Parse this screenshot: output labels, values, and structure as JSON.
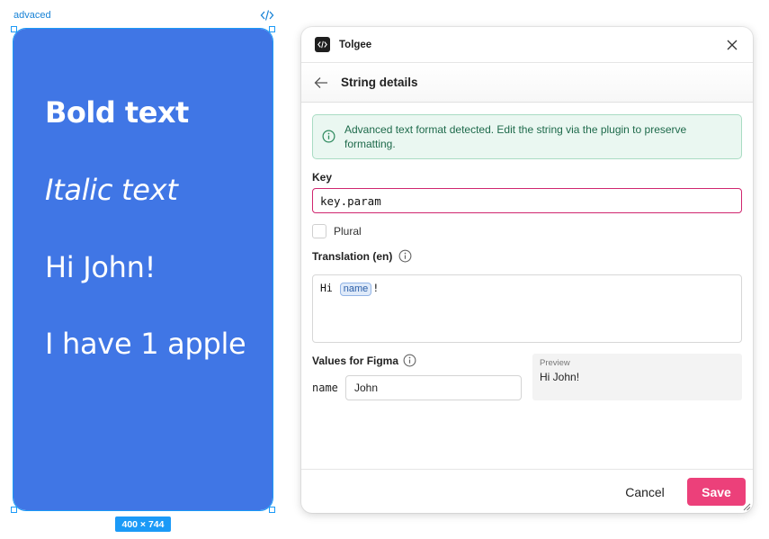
{
  "figma": {
    "frame_label": "advaced",
    "frame_size": "400 × 744",
    "texts": {
      "bold": "Bold text",
      "italic": "Italic text",
      "hi": "Hi John!",
      "apple": "I have 1 apple"
    },
    "frame_color": "#4076e5",
    "selection_color": "#1b9af7"
  },
  "plugin": {
    "app_title": "Tolgee",
    "page_title": "String details",
    "alert": {
      "text": "Advanced text format detected. Edit the string via the plugin to preserve formatting.",
      "icon": "info-circle-icon"
    },
    "key": {
      "label": "Key",
      "value": "key.param"
    },
    "plural": {
      "label": "Plural",
      "checked": false
    },
    "translation": {
      "label": "Translation (en)",
      "prefix": "Hi ",
      "param": "name",
      "suffix": "!"
    },
    "values": {
      "label": "Values for Figma",
      "param_name": "name",
      "param_value": "John"
    },
    "preview": {
      "caption": "Preview",
      "text": "Hi John!"
    },
    "buttons": {
      "cancel": "Cancel",
      "save": "Save"
    },
    "accent_color": "#ec407a"
  }
}
